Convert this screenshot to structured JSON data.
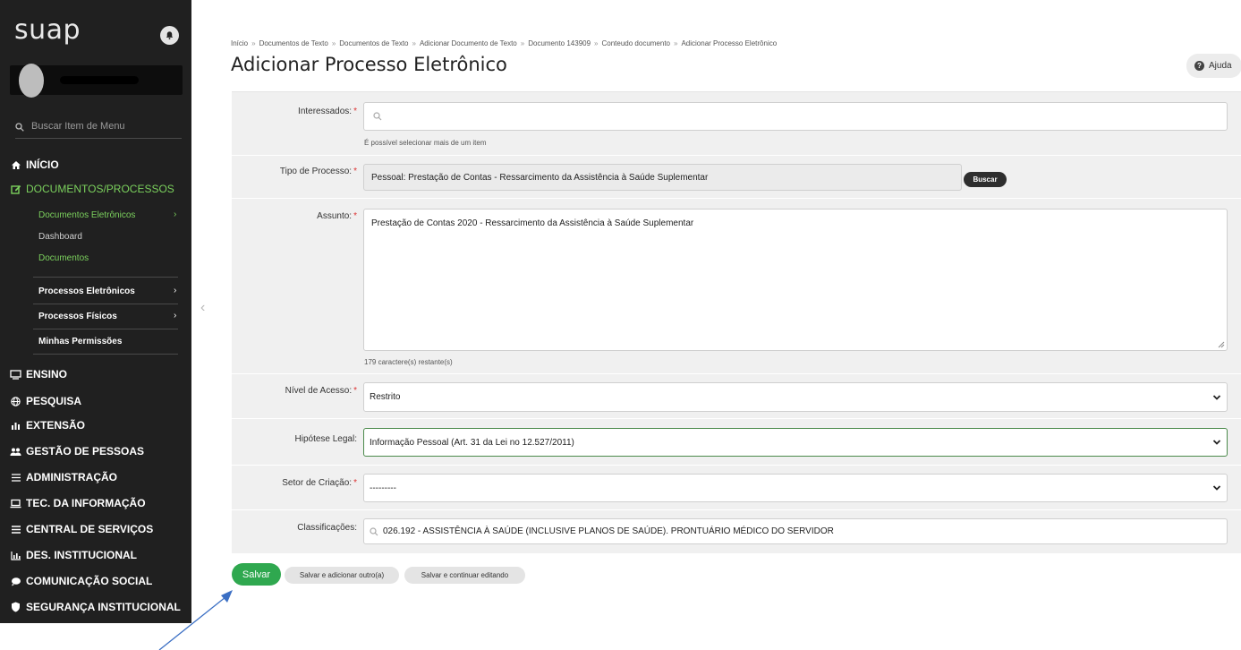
{
  "sidebar": {
    "logo": "suap",
    "search_placeholder": "Buscar Item de Menu",
    "top_items": [
      {
        "label": "INÍCIO",
        "icon": "home-icon"
      },
      {
        "label": "DOCUMENTOS/PROCESSOS",
        "icon": "edit-icon"
      },
      {
        "label": "ENSINO",
        "icon": "ensino-icon"
      },
      {
        "label": "PESQUISA",
        "icon": "globe-icon"
      },
      {
        "label": "EXTENSÃO",
        "icon": "chart-icon"
      },
      {
        "label": "GESTÃO DE PESSOAS",
        "icon": "users-icon"
      },
      {
        "label": "ADMINISTRAÇÃO",
        "icon": "list-icon"
      },
      {
        "label": "TEC. DA INFORMAÇÃO",
        "icon": "laptop-icon"
      },
      {
        "label": "CENTRAL DE SERVIÇOS",
        "icon": "menu-icon"
      },
      {
        "label": "DES. INSTITUCIONAL",
        "icon": "bar-chart-icon"
      },
      {
        "label": "COMUNICAÇÃO SOCIAL",
        "icon": "chat-icon"
      },
      {
        "label": "SEGURANÇA INSTITUCIONAL",
        "icon": "shield-icon"
      }
    ],
    "sub_items": [
      {
        "label": "Documentos Eletrônicos"
      },
      {
        "label": "Dashboard"
      },
      {
        "label": "Documentos"
      },
      {
        "label": "Processos Eletrônicos"
      },
      {
        "label": "Processos Físicos"
      },
      {
        "label": "Minhas Permissões"
      }
    ]
  },
  "breadcrumb": [
    "Início",
    "Documentos de Texto",
    "Documentos de Texto",
    "Adicionar Documento de Texto",
    "Documento 143909",
    "Conteudo documento",
    "Adicionar Processo Eletrônico"
  ],
  "page_title": "Adicionar Processo Eletrônico",
  "help_label": "Ajuda",
  "form": {
    "interessados": {
      "label": "Interessados:",
      "help": "É possível selecionar mais de um item"
    },
    "tipo_processo": {
      "label": "Tipo de Processo:",
      "value": "Pessoal: Prestação de Contas - Ressarcimento da Assistência à Saúde Suplementar",
      "button": "Buscar"
    },
    "assunto": {
      "label": "Assunto:",
      "value": "Prestação de Contas 2020 - Ressarcimento da Assistência à Saúde Suplementar",
      "help": "179 caractere(s) restante(s)"
    },
    "nivel_acesso": {
      "label": "Nível de Acesso:",
      "value": "Restrito"
    },
    "hipotese_legal": {
      "label": "Hipótese Legal:",
      "value": "Informação Pessoal (Art. 31 da Lei no 12.527/2011)"
    },
    "setor_criacao": {
      "label": "Setor de Criação:",
      "value": "---------"
    },
    "classificacoes": {
      "label": "Classificações:",
      "value": "026.192 - ASSISTÊNCIA À SAÚDE (INCLUSIVE PLANOS DE SAÚDE). PRONTUÁRIO MÉDICO DO SERVIDOR"
    }
  },
  "actions": {
    "save": "Salvar",
    "save_add": "Salvar e adicionar outro(a)",
    "save_continue": "Salvar e continuar editando"
  },
  "colors": {
    "sidebar_bg": "#202020",
    "accent_green": "#7bd15d",
    "save_green": "#2fa84f",
    "annotation_blue": "#3b6fc4"
  }
}
